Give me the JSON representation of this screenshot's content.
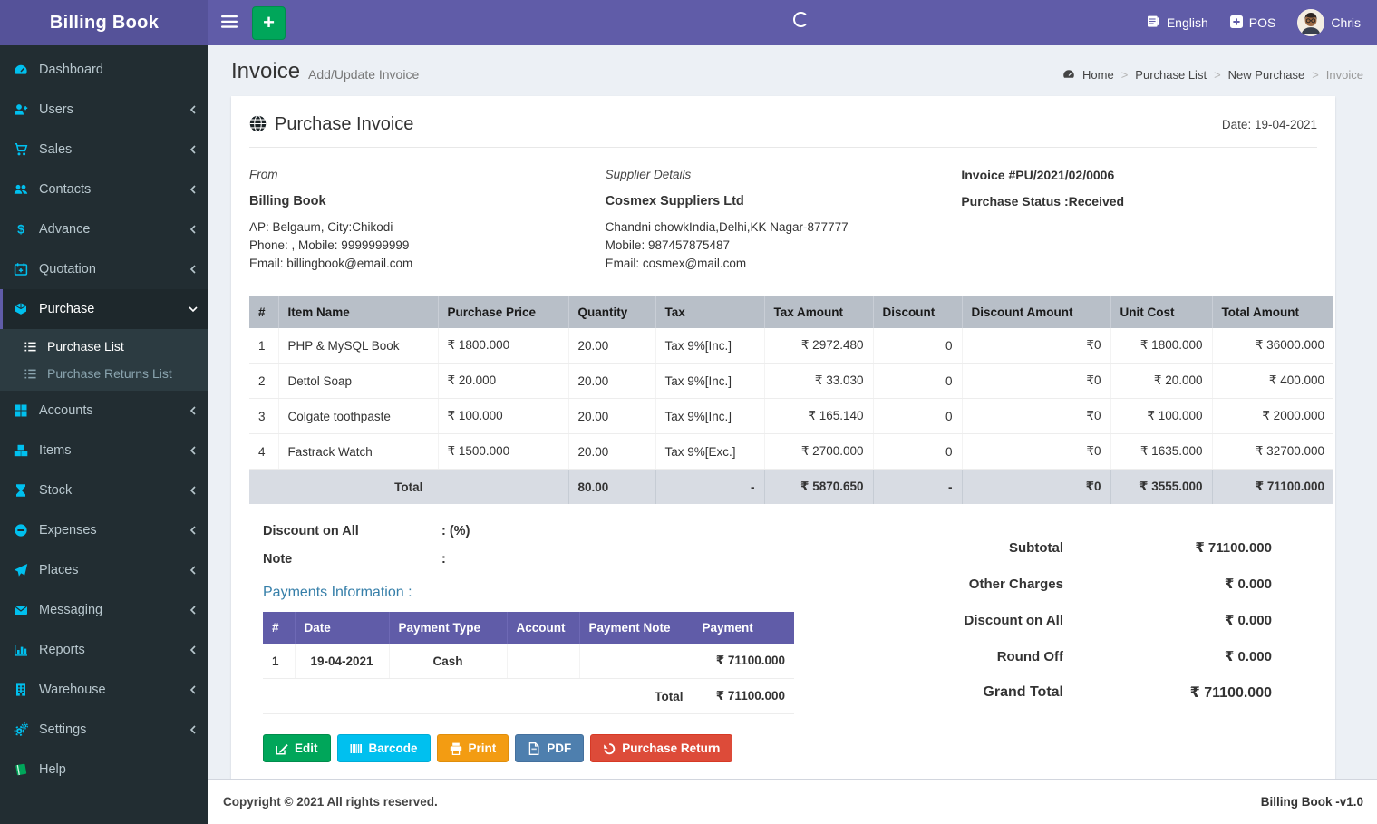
{
  "app": {
    "title": "Billing Book",
    "version": "Billing Book -v1.0",
    "copyright": "Copyright © 2021 All rights reserved."
  },
  "topbar": {
    "language": "English",
    "pos": "POS",
    "user": "Chris",
    "add_label": "+",
    "icons": {
      "menu": "hamburger",
      "add": "plus",
      "language": "language-book",
      "pos": "plus-square",
      "user": "avatar",
      "loading": "spinner"
    }
  },
  "sidebar": {
    "items": [
      {
        "label": "Dashboard",
        "icon": "dashboard-gauge"
      },
      {
        "label": "Users",
        "icon": "user-plus"
      },
      {
        "label": "Sales",
        "icon": "shopping-cart"
      },
      {
        "label": "Contacts",
        "icon": "users-group"
      },
      {
        "label": "Advance",
        "icon": "dollar"
      },
      {
        "label": "Quotation",
        "icon": "calendar-plus"
      },
      {
        "label": "Purchase",
        "icon": "cube",
        "active": true,
        "expanded": true
      },
      {
        "label": "Accounts",
        "icon": "grid"
      },
      {
        "label": "Items",
        "icon": "cubes"
      },
      {
        "label": "Stock",
        "icon": "hourglass"
      },
      {
        "label": "Expenses",
        "icon": "minus-circle"
      },
      {
        "label": "Places",
        "icon": "paper-plane"
      },
      {
        "label": "Messaging",
        "icon": "envelope"
      },
      {
        "label": "Reports",
        "icon": "bar-chart"
      },
      {
        "label": "Warehouse",
        "icon": "building"
      },
      {
        "label": "Settings",
        "icon": "gears"
      },
      {
        "label": "Help",
        "icon": "book-green"
      }
    ],
    "purchase_submenu": [
      {
        "label": "Purchase List",
        "icon": "list",
        "active": true
      },
      {
        "label": "Purchase Returns List",
        "icon": "list",
        "active": false
      }
    ]
  },
  "page": {
    "title": "Invoice",
    "subtitle": "Add/Update Invoice",
    "breadcrumb": [
      "Home",
      "Purchase List",
      "New Purchase",
      "Invoice"
    ]
  },
  "invoice": {
    "heading": "Purchase Invoice",
    "date": "Date: 19-04-2021",
    "from": {
      "label": "From",
      "name": "Billing Book",
      "address": "AP: Belgaum, City:Chikodi",
      "phone": "Phone: , Mobile: 9999999999",
      "email": "Email: billingbook@email.com"
    },
    "supplier": {
      "label": "Supplier Details",
      "name": "Cosmex Suppliers Ltd",
      "address": "Chandni chowkIndia,Delhi,KK Nagar-877777",
      "phone": "Mobile: 987457875487",
      "email": "Email: cosmex@mail.com"
    },
    "meta": {
      "number": "Invoice #PU/2021/02/0006",
      "status": "Purchase Status :Received"
    }
  },
  "items_table": {
    "headers": [
      "#",
      "Item Name",
      "Purchase Price",
      "Quantity",
      "Tax",
      "Tax Amount",
      "Discount",
      "Discount Amount",
      "Unit Cost",
      "Total Amount"
    ],
    "rows": [
      [
        "1",
        "PHP & MySQL Book",
        "₹ 1800.000",
        "20.00",
        "Tax 9%[Inc.]",
        "₹ 2972.480",
        "0",
        "₹0",
        "₹ 1800.000",
        "₹ 36000.000"
      ],
      [
        "2",
        "Dettol Soap",
        "₹ 20.000",
        "20.00",
        "Tax 9%[Inc.]",
        "₹ 33.030",
        "0",
        "₹0",
        "₹ 20.000",
        "₹ 400.000"
      ],
      [
        "3",
        "Colgate toothpaste",
        "₹ 100.000",
        "20.00",
        "Tax 9%[Inc.]",
        "₹ 165.140",
        "0",
        "₹0",
        "₹ 100.000",
        "₹ 2000.000"
      ],
      [
        "4",
        "Fastrack Watch",
        "₹ 1500.000",
        "20.00",
        "Tax 9%[Exc.]",
        "₹ 2700.000",
        "0",
        "₹0",
        "₹ 1635.000",
        "₹ 32700.000"
      ]
    ],
    "total_row": {
      "label": "Total",
      "quantity": "80.00",
      "tax": "-",
      "tax_amount": "₹ 5870.650",
      "discount": "-",
      "discount_amount": "₹0",
      "unit_cost": "₹ 3555.000",
      "total_amount": "₹ 71100.000"
    }
  },
  "adjustments": {
    "discount_label": "Discount on All",
    "discount_value": ": (%)",
    "note_label": "Note",
    "note_value": ":"
  },
  "payments": {
    "heading": "Payments Information :",
    "headers": [
      "#",
      "Date",
      "Payment Type",
      "Account",
      "Payment Note",
      "Payment"
    ],
    "rows": [
      [
        "1",
        "19-04-2021",
        "Cash",
        "",
        "",
        "₹ 71100.000"
      ]
    ],
    "total_label": "Total",
    "total_value": "₹ 71100.000"
  },
  "summary": {
    "rows": [
      {
        "label": "Subtotal",
        "value": "₹ 71100.000"
      },
      {
        "label": "Other Charges",
        "value": "₹ 0.000"
      },
      {
        "label": "Discount on All",
        "value": "₹ 0.000"
      },
      {
        "label": "Round Off",
        "value": "₹ 0.000"
      },
      {
        "label": "Grand Total",
        "value": "₹ 71100.000"
      }
    ]
  },
  "actions": [
    {
      "label": "Edit",
      "icon": "edit-pencil",
      "color": "#00a65a"
    },
    {
      "label": "Barcode",
      "icon": "barcode",
      "color": "#00c0ef"
    },
    {
      "label": "Print",
      "icon": "printer",
      "color": "#f39c12"
    },
    {
      "label": "PDF",
      "icon": "file-pdf",
      "color": "#4e7fae"
    },
    {
      "label": "Purchase Return",
      "icon": "undo-arrow",
      "color": "#dd4b39"
    }
  ],
  "colors": {
    "navbar_purple": "#605ca8",
    "logo_purple": "#555299",
    "sidebar_dark": "#222d32",
    "submenu_dark": "#2c3b41",
    "icon_cyan": "#00c0ef",
    "success_green": "#00a65a",
    "table_header_gray": "#b8bfc8",
    "total_row_gray": "#d8dce3",
    "content_bg": "#ecf0f5",
    "heading_teal": "#367fa9",
    "danger_red": "#dd4b39",
    "warning_orange": "#f39c12",
    "pdf_blue": "#4e7fae"
  }
}
